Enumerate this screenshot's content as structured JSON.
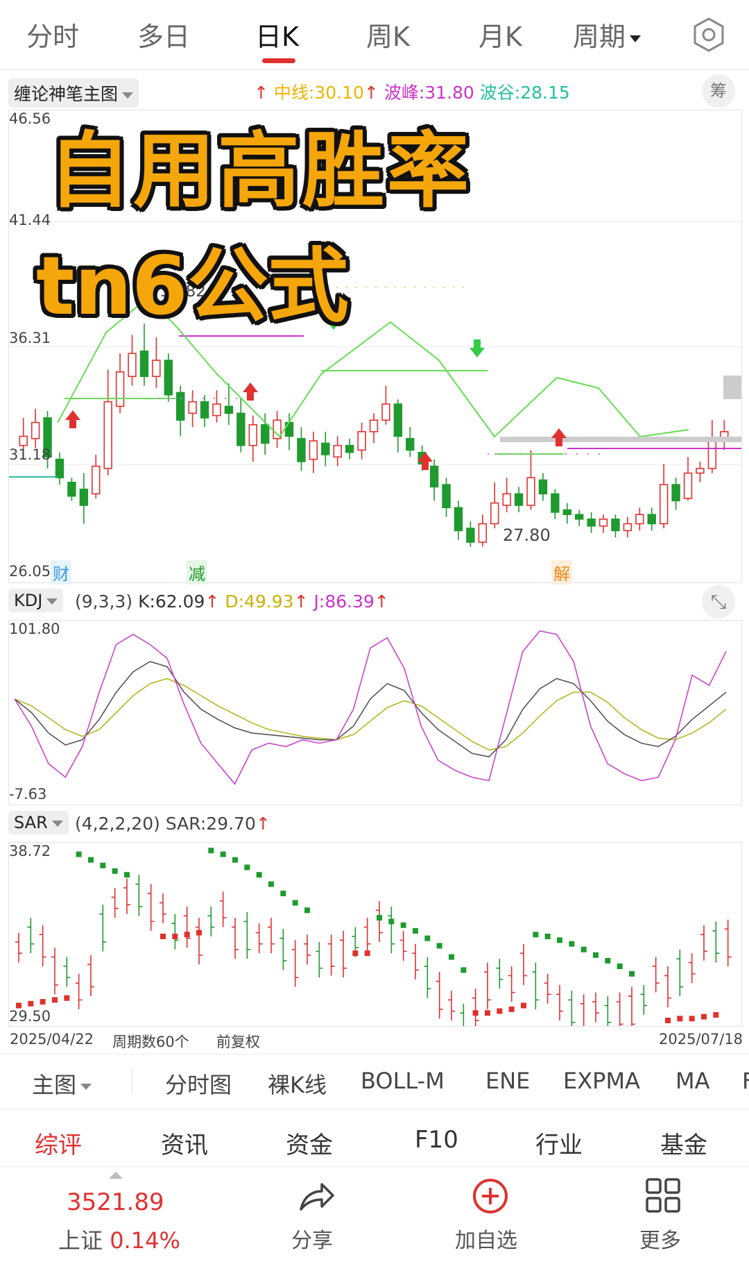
{
  "tabs": [
    {
      "label": "分时"
    },
    {
      "label": "多日"
    },
    {
      "label": "日K"
    },
    {
      "label": "周K"
    },
    {
      "label": "月K"
    },
    {
      "label": "周期"
    }
  ],
  "active_tab": "日K",
  "main_chart": {
    "indicator_name": "缠论神笔主图",
    "zhongxian_label": "中线:",
    "zhongxian_value": "30.10",
    "bofeng_label": "波峰:",
    "bofeng_value": "31.80",
    "bogu_label": "波谷:",
    "bogu_value": "28.15",
    "chip_button": "筹",
    "y_labels": [
      "46.56",
      "41.44",
      "36.31",
      "31.18",
      "26.05"
    ],
    "peak_label": "37.82",
    "low_label": "27.80",
    "markers": [
      "财",
      "减",
      "解"
    ],
    "colors": {
      "up": "#e0312f",
      "down": "#1f9a2f",
      "peak_line": "#cc33cc",
      "trend_line": "#66dd55"
    }
  },
  "overlay": {
    "line1": "自用高胜率",
    "line2": "tn6公式"
  },
  "kdj": {
    "name": "KDJ",
    "params": "(9,3,3)",
    "k": "K:62.09",
    "d": "D:49.93",
    "j": "J:86.39",
    "y_max": "101.80",
    "y_min": "-7.63",
    "k_series": [
      58,
      50,
      38,
      31,
      34,
      46,
      62,
      74,
      80,
      77,
      62,
      52,
      46,
      41,
      38,
      37,
      36,
      35,
      34,
      34,
      42,
      58,
      67,
      63,
      50,
      40,
      33,
      26,
      24,
      34,
      52,
      64,
      70,
      67,
      57,
      45,
      37,
      32,
      30,
      36,
      46,
      54,
      62
    ],
    "d_series": [
      58,
      54,
      47,
      40,
      36,
      40,
      50,
      60,
      67,
      70,
      66,
      60,
      54,
      49,
      44,
      40,
      38,
      36,
      35,
      34,
      37,
      45,
      53,
      57,
      54,
      47,
      40,
      33,
      28,
      30,
      38,
      48,
      57,
      62,
      62,
      56,
      47,
      40,
      35,
      34,
      38,
      44,
      52
    ],
    "j_series": [
      58,
      42,
      20,
      12,
      30,
      62,
      90,
      96,
      90,
      82,
      55,
      32,
      20,
      8,
      28,
      32,
      30,
      34,
      32,
      34,
      52,
      88,
      94,
      76,
      42,
      22,
      16,
      12,
      10,
      48,
      86,
      98,
      96,
      80,
      42,
      20,
      14,
      10,
      12,
      34,
      72,
      66,
      86
    ]
  },
  "sar": {
    "name": "SAR",
    "params": "(4,2,2,20)",
    "value": "SAR:29.70",
    "y_max": "38.72",
    "y_min": "29.50",
    "date_start": "2025/04/22",
    "date_end": "2025/07/18",
    "period_count": "周期数60个",
    "adjust": "前复权"
  },
  "indicator_bar": {
    "main": "主图",
    "items": [
      "分时图",
      "裸K线",
      "BOLL-M",
      "ENE",
      "EXPMA",
      "MA",
      "F"
    ]
  },
  "bottom_tabs": [
    "综评",
    "资讯",
    "资金",
    "F10",
    "行业",
    "基金"
  ],
  "footer": {
    "index_value": "3521.89",
    "index_name": "上证",
    "index_change": "0.14%",
    "share": "分享",
    "add": "加自选",
    "more": "更多"
  }
}
